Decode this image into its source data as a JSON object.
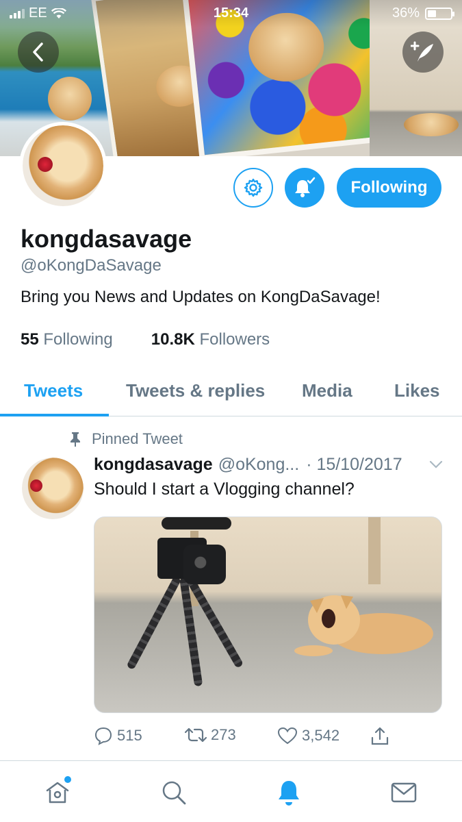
{
  "status_bar": {
    "carrier": "EE",
    "time": "15:34",
    "battery_percent": "36%",
    "battery_level": 0.36
  },
  "profile": {
    "display_name": "kongdasavage",
    "handle": "@oKongDaSavage",
    "bio": "Bring you News and Updates on KongDaSavage!",
    "following_count": "55",
    "following_label": "Following",
    "followers_count": "10.8K",
    "followers_label": "Followers",
    "follow_button_label": "Following"
  },
  "tabs": [
    {
      "label": "Tweets",
      "active": true
    },
    {
      "label": "Tweets & replies",
      "active": false
    },
    {
      "label": "Media",
      "active": false
    },
    {
      "label": "Likes",
      "active": false
    }
  ],
  "pinned_tweet": {
    "pinned_label": "Pinned Tweet",
    "author_name": "kongdasavage",
    "author_handle": "@oKong...",
    "date": "· 15/10/2017",
    "text": "Should I start a Vlogging channel?",
    "reply_count": "515",
    "retweet_count": "273",
    "like_count": "3,542"
  },
  "colors": {
    "accent": "#1da1f2",
    "secondary_text": "#657786",
    "primary_text": "#14171a"
  },
  "icons": {
    "back": "chevron-left-icon",
    "compose": "compose-tweet-icon",
    "settings": "gear-icon",
    "notifications": "bell-check-icon",
    "pin": "pin-icon",
    "reply": "comment-icon",
    "retweet": "retweet-icon",
    "like": "heart-icon",
    "share": "share-icon",
    "nav_home": "home-icon",
    "nav_search": "search-icon",
    "nav_notifications": "bell-icon",
    "nav_messages": "mail-icon"
  }
}
